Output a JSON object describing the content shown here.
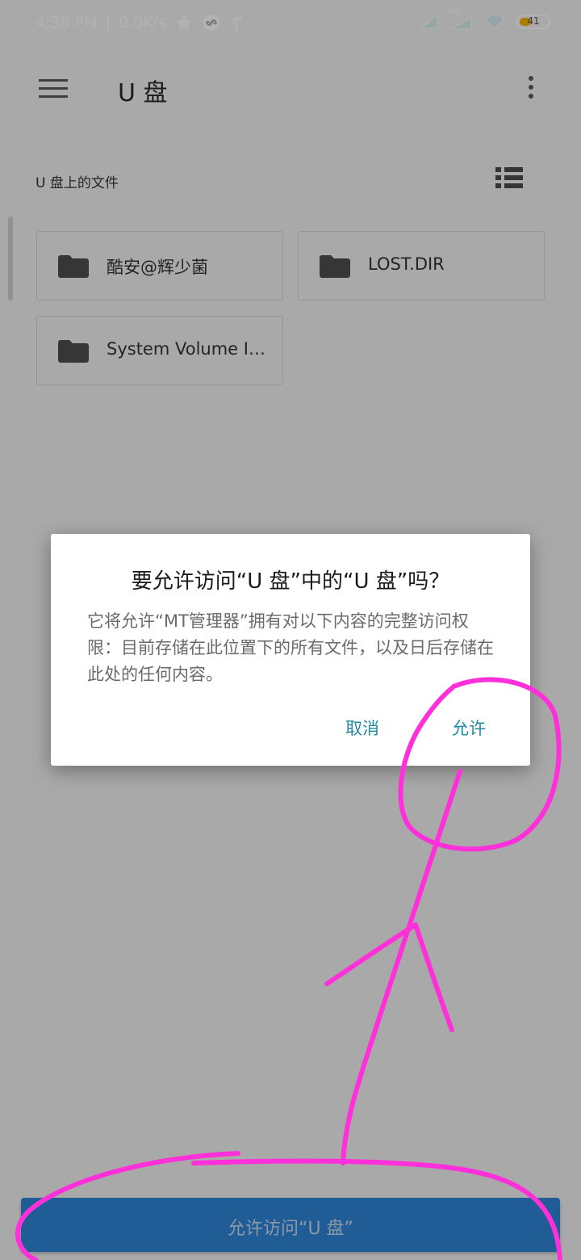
{
  "status_bar": {
    "time": "4:38 PM",
    "net_speed": "0.0K/s",
    "network_badge": "HD",
    "battery_level": "41",
    "battery_fraction": 0.41,
    "icons": [
      "star-icon",
      "infinity-icon",
      "usb-icon",
      "signal-icon",
      "signal-hd-icon",
      "wifi-icon",
      "battery-icon"
    ]
  },
  "app_bar": {
    "title": "U 盘",
    "menu_icon": "menu-icon",
    "more_icon": "more-vert-icon"
  },
  "content": {
    "section_label": "U 盘上的文件",
    "view_toggle_icon": "list-view-icon",
    "folders": [
      {
        "name": "酷安@辉少菌",
        "icon": "folder-icon"
      },
      {
        "name": "LOST.DIR",
        "icon": "folder-icon"
      },
      {
        "name": "System Volume I…",
        "icon": "folder-icon"
      }
    ]
  },
  "dialog": {
    "title": "要允许访问“U 盘”中的“U 盘”吗？",
    "body": "它将允许“MT管理器”拥有对以下内容的完整访问权限：目前存储在此位置下的所有文件，以及日后存储在此处的任何内容。",
    "cancel_label": "取消",
    "allow_label": "允许"
  },
  "bottom_button": {
    "label": "允许访问“U 盘”"
  },
  "colors": {
    "accent": "#1f8aa0",
    "primary_button": "#2f86d8",
    "annotation": "#ff2fd9",
    "folder": "#4e4e4e",
    "battery": "#f4b400"
  }
}
